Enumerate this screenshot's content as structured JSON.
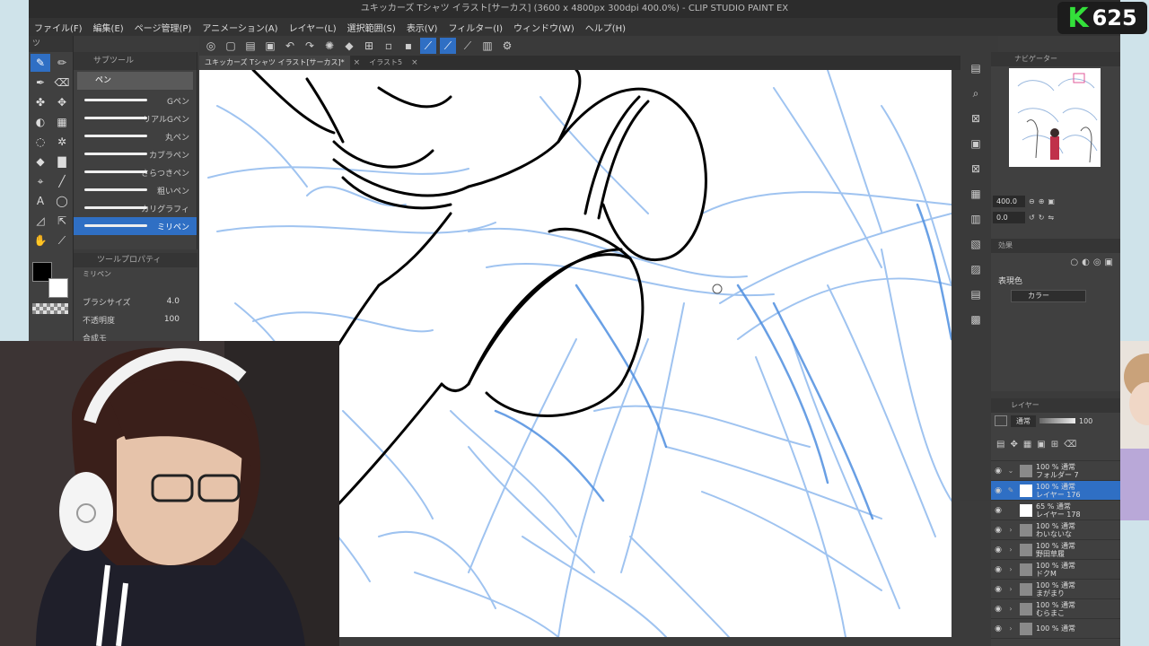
{
  "window": {
    "title": "ユキッカーズ Tシャツ イラスト[サーカス] (3600 x 4800px 300dpi 400.0%) - CLIP STUDIO PAINT EX"
  },
  "menu": [
    "ファイル(F)",
    "編集(E)",
    "ページ管理(P)",
    "アニメーション(A)",
    "レイヤー(L)",
    "選択範囲(S)",
    "表示(V)",
    "フィルター(I)",
    "ウィンドウ(W)",
    "ヘルプ(H)"
  ],
  "tool_panel": {
    "header": "ツ"
  },
  "subtool": {
    "header": "サブツール",
    "group": "ペン",
    "brushes": [
      {
        "label": "Gペン",
        "selected": false
      },
      {
        "label": "リアルGペン",
        "selected": false
      },
      {
        "label": "丸ペン",
        "selected": false
      },
      {
        "label": "カブラペン",
        "selected": false
      },
      {
        "label": "さらつきペン",
        "selected": false
      },
      {
        "label": "粗いペン",
        "selected": false
      },
      {
        "label": "カリグラフィ",
        "selected": false
      },
      {
        "label": "ミリペン",
        "selected": true
      }
    ]
  },
  "tool_property": {
    "header": "ツールプロパティ",
    "preset": "ミリペン",
    "brush_size_label": "ブラシサイズ",
    "brush_size_value": "4.0",
    "opacity_label": "不透明度",
    "opacity_value": "100",
    "blend_label": "合成モ"
  },
  "doc_tabs": [
    {
      "label": "ユキッカーズ Tシャツ イラスト[サーカス]*",
      "active": true
    },
    {
      "label": "イラスト5",
      "active": false
    }
  ],
  "navigator": {
    "header": "ナビゲーター",
    "zoom": "400.0",
    "rotation": "0.0"
  },
  "effect": {
    "header": "効果",
    "expression_color_label": "表現色",
    "expression_color_value": "カラー"
  },
  "layers": {
    "header": "レイヤー",
    "blend": "通常",
    "opacity": "100",
    "items": [
      {
        "pct": "100 %",
        "mode": "通常",
        "name": "フォルダー 7",
        "type": "folder",
        "selected": false
      },
      {
        "pct": "100 %",
        "mode": "通常",
        "name": "レイヤー 176",
        "type": "raster",
        "selected": true
      },
      {
        "pct": "65 %",
        "mode": "通常",
        "name": "レイヤー 178",
        "type": "raster",
        "selected": false
      },
      {
        "pct": "100 %",
        "mode": "通常",
        "name": "わいないな",
        "type": "folder",
        "selected": false
      },
      {
        "pct": "100 %",
        "mode": "通常",
        "name": "野田草履",
        "type": "folder",
        "selected": false
      },
      {
        "pct": "100 %",
        "mode": "通常",
        "name": "ドクM",
        "type": "folder",
        "selected": false
      },
      {
        "pct": "100 %",
        "mode": "通常",
        "name": "まがまり",
        "type": "folder",
        "selected": false
      },
      {
        "pct": "100 %",
        "mode": "通常",
        "name": "むらまこ",
        "type": "folder",
        "selected": false
      },
      {
        "pct": "100 %",
        "mode": "通常",
        "name": "",
        "type": "folder",
        "selected": false
      }
    ]
  },
  "overlay": {
    "logo_letter": "K",
    "logo_number": "625"
  },
  "colors": {
    "accent": "#2f6fc4",
    "sketch": "#6fa3e6",
    "ink": "#000000"
  }
}
